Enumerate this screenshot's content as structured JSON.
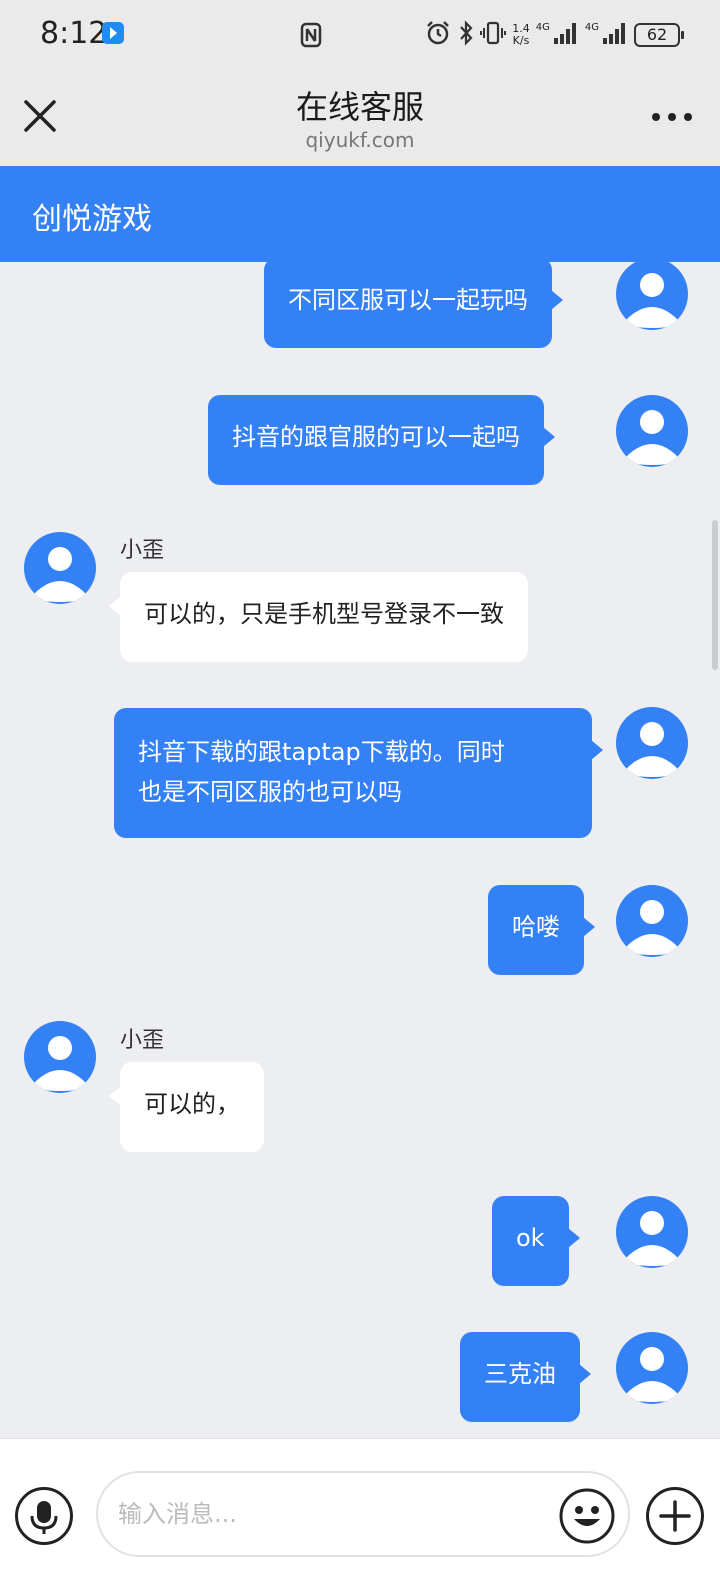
{
  "status_bar": {
    "time": "8:12",
    "net_speed_top": "1.4",
    "net_speed_bottom": "K/s",
    "net_type": "4G",
    "battery": "62"
  },
  "header": {
    "title": "在线客服",
    "subtitle": "qiyukf.com"
  },
  "banner": {
    "title": "创悦游戏"
  },
  "colors": {
    "accent": "#3480f5",
    "chat_bg": "#eceef1"
  },
  "messages": [
    {
      "from": "user",
      "text": "不同区服可以一起玩吗"
    },
    {
      "from": "user",
      "text": "抖音的跟官服的可以一起吗"
    },
    {
      "from": "agent",
      "sender": "小歪",
      "text": "可以的，只是手机型号登录不一致"
    },
    {
      "from": "user",
      "text_line1": "抖音下载的跟taptap下载的。同时",
      "text_line2": "也是不同区服的也可以吗"
    },
    {
      "from": "user",
      "text": "哈喽"
    },
    {
      "from": "agent",
      "sender": "小歪",
      "text": "可以的，"
    },
    {
      "from": "user",
      "text": "ok"
    },
    {
      "from": "user",
      "text": "三克油"
    }
  ],
  "input": {
    "placeholder": "输入消息..."
  },
  "icons": {
    "close": "close-icon",
    "more": "more-dots-icon",
    "mic": "microphone-icon",
    "emoji": "emoji-icon",
    "plus": "plus-icon",
    "avatar": "user-avatar-icon"
  }
}
